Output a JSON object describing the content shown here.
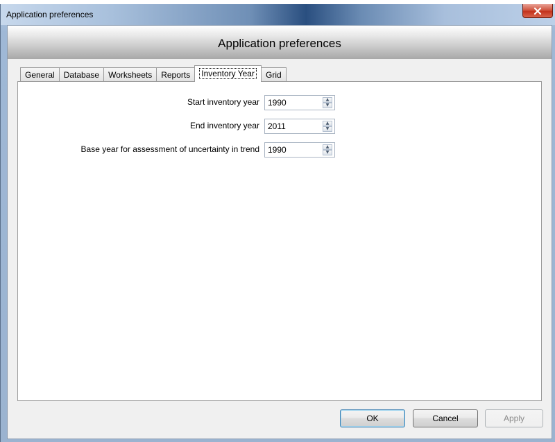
{
  "window": {
    "title": "Application preferences",
    "close_glyph": "x"
  },
  "header": {
    "title": "Application preferences"
  },
  "tabs": [
    {
      "label": "General",
      "active": false
    },
    {
      "label": "Database",
      "active": false
    },
    {
      "label": "Worksheets",
      "active": false
    },
    {
      "label": "Reports",
      "active": false
    },
    {
      "label": "Inventory Year",
      "active": true
    },
    {
      "label": "Grid",
      "active": false
    }
  ],
  "fields": {
    "start_year": {
      "label": "Start inventory year",
      "value": "1990"
    },
    "end_year": {
      "label": "End inventory year",
      "value": "2011"
    },
    "base_year": {
      "label": "Base year for assessment of uncertainty in trend",
      "value": "1990"
    }
  },
  "buttons": {
    "ok": "OK",
    "cancel": "Cancel",
    "apply": "Apply"
  }
}
